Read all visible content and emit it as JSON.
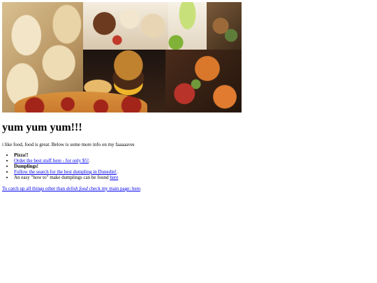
{
  "header": {
    "title": "yum yum yum!!!",
    "intro": "i like food, food is great. Below is some more info on my faaaaaves"
  },
  "list": {
    "pizza_heading": "Pizza!!",
    "pizza_link": "Order the best stuff here - for only $5!",
    "pizza_link_suffix": ".",
    "dumplings_heading": "Dumplings!",
    "dumplings_link": "Follow the search for the best dumpling in Dunedin!",
    "dumplings_link_suffix": ".",
    "howto_text": "An easy \"how to\" make dumplings can be found ",
    "howto_link": "here"
  },
  "footer": {
    "part1": "To catch up all things other than ",
    "emphasis": "delish food",
    "part2": " check my main page: ",
    "link": "here",
    "suffix": "."
  }
}
